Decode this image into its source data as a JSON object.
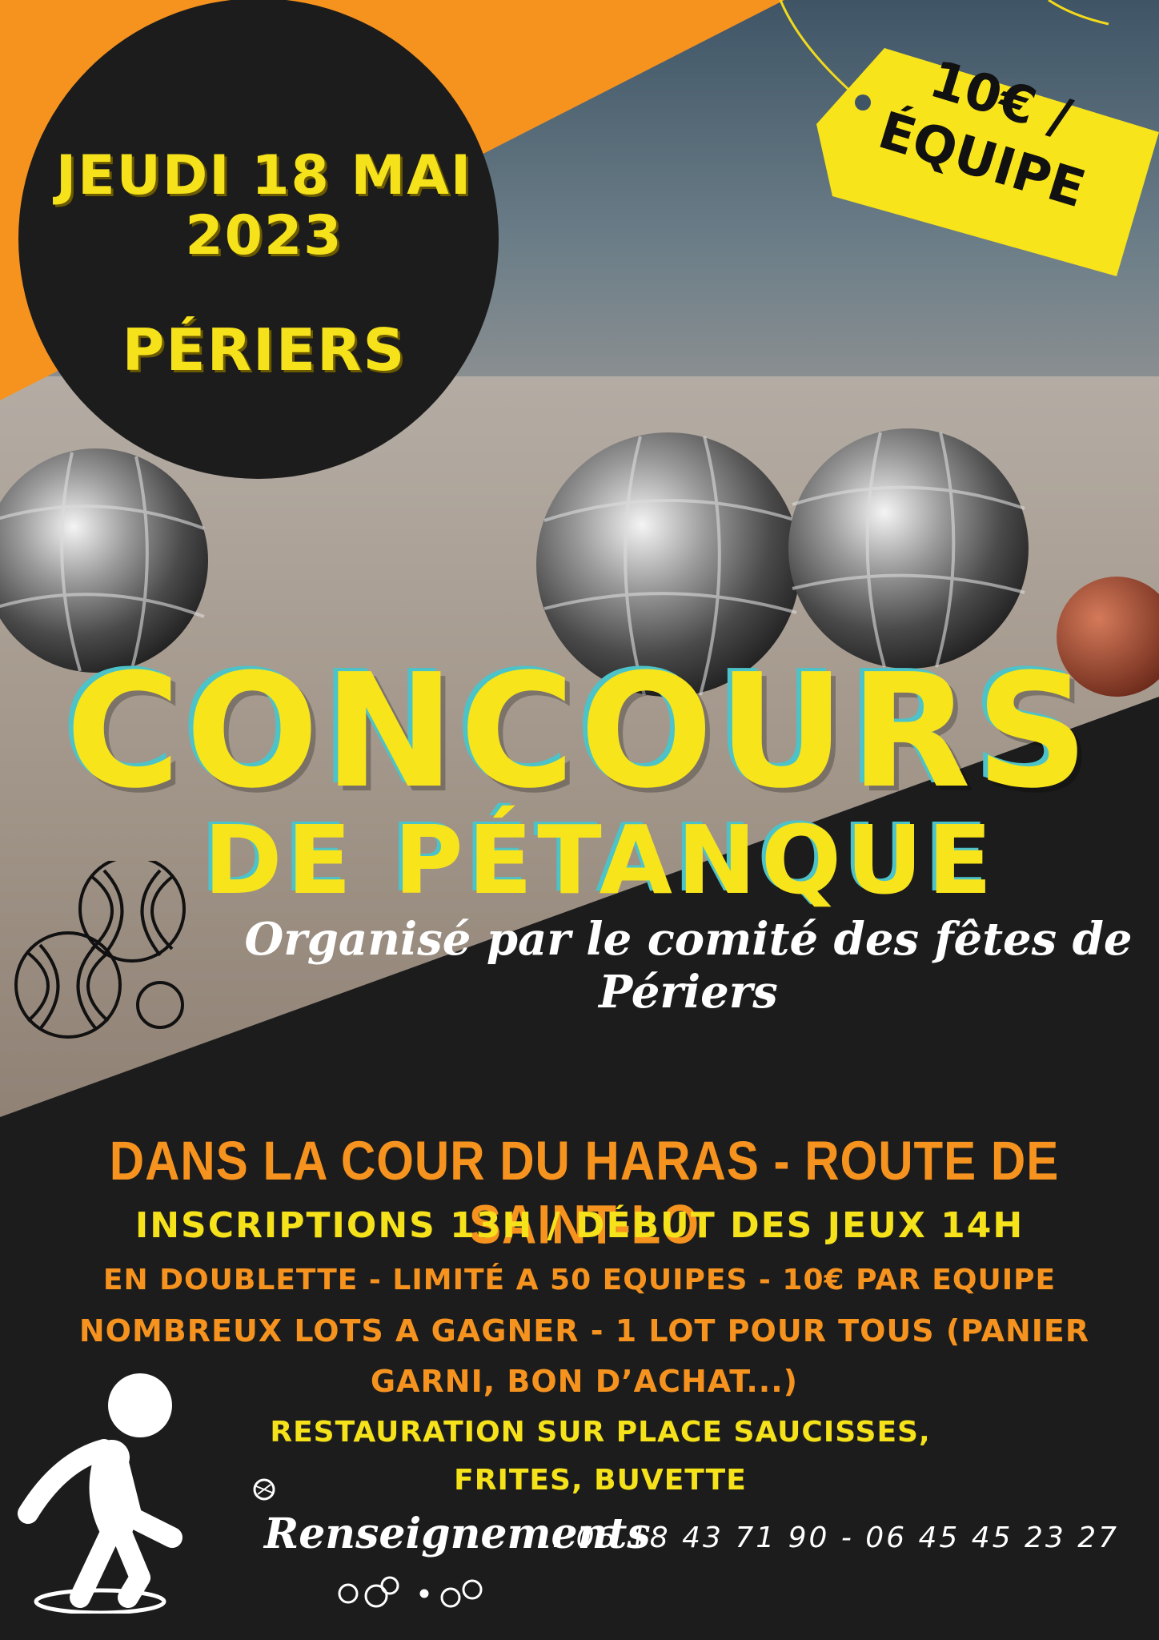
{
  "date": {
    "line1": "JEUDI 18 MAI",
    "line2": "2023",
    "town": "PÉRIERS"
  },
  "price_tag": {
    "line1": "10€ /",
    "line2": "ÉQUIPE"
  },
  "title": {
    "main": "CONCOURS",
    "sub": "DE PÉTANQUE"
  },
  "organiser": "Organisé par le comité des fêtes de Périers",
  "details": {
    "location": "DANS LA COUR DU HARAS - ROUTE DE SAINT-LO",
    "hours": "INSCRIPTIONS 13H / DÉBUT DES JEUX 14H",
    "format": "EN DOUBLETTE - LIMITÉ A 50 EQUIPES - 10€ PAR EQUIPE",
    "prizes_line1": "NOMBREUX LOTS A GAGNER - 1 LOT POUR TOUS (PANIER",
    "prizes_line2": "GARNI, BON D’ACHAT...)",
    "food_line1": "RESTAURATION SUR PLACE SAUCISSES,",
    "food_line2": "FRITES, BUVETTE"
  },
  "contact": {
    "label": "Renseignements",
    "phones": ": 06 18 43 71 90  -  06 45 45 23 27"
  },
  "colors": {
    "orange": "#f6931f",
    "yellow": "#f6e21a",
    "dark": "#1c1c1c",
    "teal_shadow": "#4cc3c9"
  },
  "icons": [
    "petanque-balls-outline-icon",
    "player-pictogram-icon",
    "small-balls-icon"
  ]
}
